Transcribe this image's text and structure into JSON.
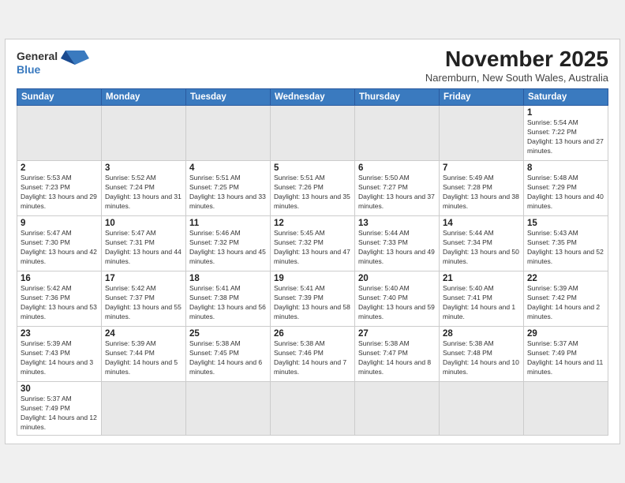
{
  "header": {
    "logo_general": "General",
    "logo_blue": "Blue",
    "month_title": "November 2025",
    "subtitle": "Naremburn, New South Wales, Australia"
  },
  "weekdays": [
    "Sunday",
    "Monday",
    "Tuesday",
    "Wednesday",
    "Thursday",
    "Friday",
    "Saturday"
  ],
  "weeks": [
    [
      {
        "day": "",
        "empty": true
      },
      {
        "day": "",
        "empty": true
      },
      {
        "day": "",
        "empty": true
      },
      {
        "day": "",
        "empty": true
      },
      {
        "day": "",
        "empty": true
      },
      {
        "day": "",
        "empty": true
      },
      {
        "day": "1",
        "sunrise": "Sunrise: 5:54 AM",
        "sunset": "Sunset: 7:22 PM",
        "daylight": "Daylight: 13 hours and 27 minutes."
      }
    ],
    [
      {
        "day": "2",
        "sunrise": "Sunrise: 5:53 AM",
        "sunset": "Sunset: 7:23 PM",
        "daylight": "Daylight: 13 hours and 29 minutes."
      },
      {
        "day": "3",
        "sunrise": "Sunrise: 5:52 AM",
        "sunset": "Sunset: 7:24 PM",
        "daylight": "Daylight: 13 hours and 31 minutes."
      },
      {
        "day": "4",
        "sunrise": "Sunrise: 5:51 AM",
        "sunset": "Sunset: 7:25 PM",
        "daylight": "Daylight: 13 hours and 33 minutes."
      },
      {
        "day": "5",
        "sunrise": "Sunrise: 5:51 AM",
        "sunset": "Sunset: 7:26 PM",
        "daylight": "Daylight: 13 hours and 35 minutes."
      },
      {
        "day": "6",
        "sunrise": "Sunrise: 5:50 AM",
        "sunset": "Sunset: 7:27 PM",
        "daylight": "Daylight: 13 hours and 37 minutes."
      },
      {
        "day": "7",
        "sunrise": "Sunrise: 5:49 AM",
        "sunset": "Sunset: 7:28 PM",
        "daylight": "Daylight: 13 hours and 38 minutes."
      },
      {
        "day": "8",
        "sunrise": "Sunrise: 5:48 AM",
        "sunset": "Sunset: 7:29 PM",
        "daylight": "Daylight: 13 hours and 40 minutes."
      }
    ],
    [
      {
        "day": "9",
        "sunrise": "Sunrise: 5:47 AM",
        "sunset": "Sunset: 7:30 PM",
        "daylight": "Daylight: 13 hours and 42 minutes."
      },
      {
        "day": "10",
        "sunrise": "Sunrise: 5:47 AM",
        "sunset": "Sunset: 7:31 PM",
        "daylight": "Daylight: 13 hours and 44 minutes."
      },
      {
        "day": "11",
        "sunrise": "Sunrise: 5:46 AM",
        "sunset": "Sunset: 7:32 PM",
        "daylight": "Daylight: 13 hours and 45 minutes."
      },
      {
        "day": "12",
        "sunrise": "Sunrise: 5:45 AM",
        "sunset": "Sunset: 7:32 PM",
        "daylight": "Daylight: 13 hours and 47 minutes."
      },
      {
        "day": "13",
        "sunrise": "Sunrise: 5:44 AM",
        "sunset": "Sunset: 7:33 PM",
        "daylight": "Daylight: 13 hours and 49 minutes."
      },
      {
        "day": "14",
        "sunrise": "Sunrise: 5:44 AM",
        "sunset": "Sunset: 7:34 PM",
        "daylight": "Daylight: 13 hours and 50 minutes."
      },
      {
        "day": "15",
        "sunrise": "Sunrise: 5:43 AM",
        "sunset": "Sunset: 7:35 PM",
        "daylight": "Daylight: 13 hours and 52 minutes."
      }
    ],
    [
      {
        "day": "16",
        "sunrise": "Sunrise: 5:42 AM",
        "sunset": "Sunset: 7:36 PM",
        "daylight": "Daylight: 13 hours and 53 minutes."
      },
      {
        "day": "17",
        "sunrise": "Sunrise: 5:42 AM",
        "sunset": "Sunset: 7:37 PM",
        "daylight": "Daylight: 13 hours and 55 minutes."
      },
      {
        "day": "18",
        "sunrise": "Sunrise: 5:41 AM",
        "sunset": "Sunset: 7:38 PM",
        "daylight": "Daylight: 13 hours and 56 minutes."
      },
      {
        "day": "19",
        "sunrise": "Sunrise: 5:41 AM",
        "sunset": "Sunset: 7:39 PM",
        "daylight": "Daylight: 13 hours and 58 minutes."
      },
      {
        "day": "20",
        "sunrise": "Sunrise: 5:40 AM",
        "sunset": "Sunset: 7:40 PM",
        "daylight": "Daylight: 13 hours and 59 minutes."
      },
      {
        "day": "21",
        "sunrise": "Sunrise: 5:40 AM",
        "sunset": "Sunset: 7:41 PM",
        "daylight": "Daylight: 14 hours and 1 minute."
      },
      {
        "day": "22",
        "sunrise": "Sunrise: 5:39 AM",
        "sunset": "Sunset: 7:42 PM",
        "daylight": "Daylight: 14 hours and 2 minutes."
      }
    ],
    [
      {
        "day": "23",
        "sunrise": "Sunrise: 5:39 AM",
        "sunset": "Sunset: 7:43 PM",
        "daylight": "Daylight: 14 hours and 3 minutes."
      },
      {
        "day": "24",
        "sunrise": "Sunrise: 5:39 AM",
        "sunset": "Sunset: 7:44 PM",
        "daylight": "Daylight: 14 hours and 5 minutes."
      },
      {
        "day": "25",
        "sunrise": "Sunrise: 5:38 AM",
        "sunset": "Sunset: 7:45 PM",
        "daylight": "Daylight: 14 hours and 6 minutes."
      },
      {
        "day": "26",
        "sunrise": "Sunrise: 5:38 AM",
        "sunset": "Sunset: 7:46 PM",
        "daylight": "Daylight: 14 hours and 7 minutes."
      },
      {
        "day": "27",
        "sunrise": "Sunrise: 5:38 AM",
        "sunset": "Sunset: 7:47 PM",
        "daylight": "Daylight: 14 hours and 8 minutes."
      },
      {
        "day": "28",
        "sunrise": "Sunrise: 5:38 AM",
        "sunset": "Sunset: 7:48 PM",
        "daylight": "Daylight: 14 hours and 10 minutes."
      },
      {
        "day": "29",
        "sunrise": "Sunrise: 5:37 AM",
        "sunset": "Sunset: 7:49 PM",
        "daylight": "Daylight: 14 hours and 11 minutes."
      }
    ],
    [
      {
        "day": "30",
        "sunrise": "Sunrise: 5:37 AM",
        "sunset": "Sunset: 7:49 PM",
        "daylight": "Daylight: 14 hours and 12 minutes."
      },
      {
        "day": "",
        "empty": true
      },
      {
        "day": "",
        "empty": true
      },
      {
        "day": "",
        "empty": true
      },
      {
        "day": "",
        "empty": true
      },
      {
        "day": "",
        "empty": true
      },
      {
        "day": "",
        "empty": true
      }
    ]
  ]
}
